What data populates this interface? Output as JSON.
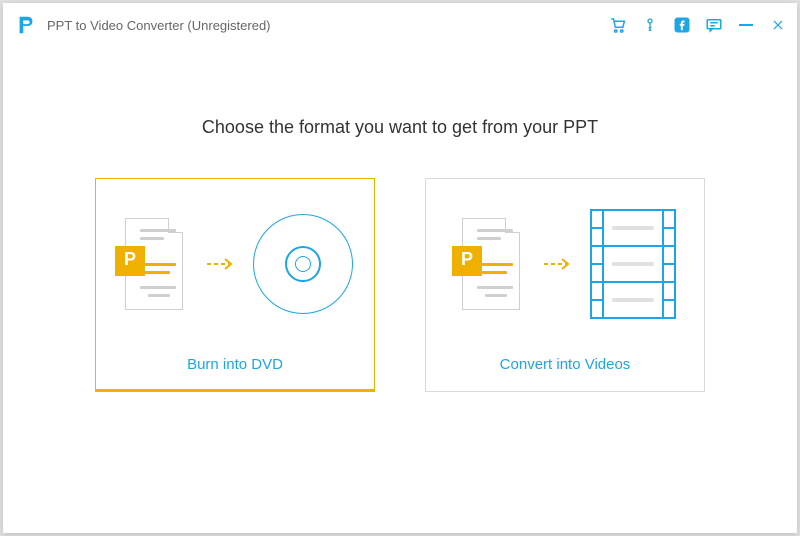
{
  "window": {
    "title": "PPT to Video Converter (Unregistered)"
  },
  "main": {
    "heading": "Choose the format you want to get from your PPT",
    "options": {
      "dvd": {
        "label": "Burn into DVD"
      },
      "video": {
        "label": "Convert into Videos"
      }
    }
  },
  "icons": {
    "logo": "P",
    "cart": "cart-icon",
    "key": "key-icon",
    "facebook": "facebook-icon",
    "feedback": "feedback-icon",
    "minimize": "minimize-icon",
    "close": "close-icon"
  }
}
